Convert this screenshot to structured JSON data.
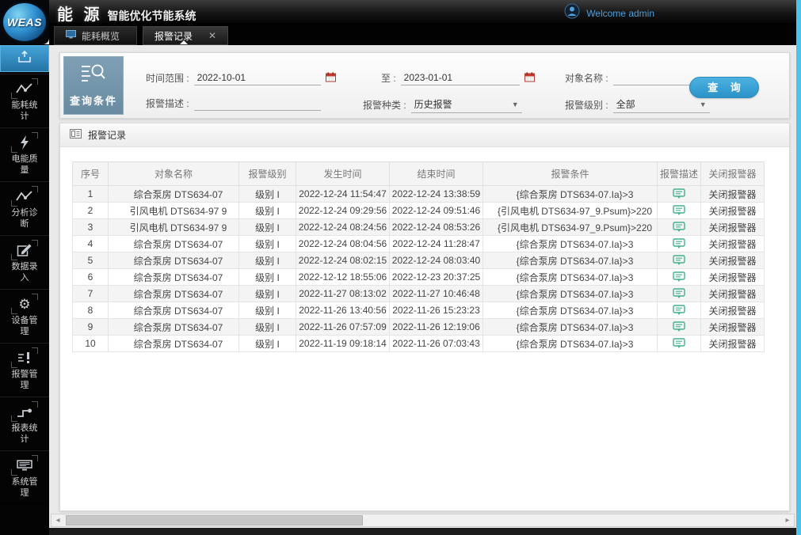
{
  "app": {
    "logo": "WEAS",
    "title_main": "能 源",
    "title_sub": "智能优化节能系统",
    "welcome": "Welcome admin"
  },
  "tabs": [
    {
      "label": "能耗概览",
      "active": false
    },
    {
      "label": "报警记录",
      "active": true,
      "close": "✕"
    }
  ],
  "sidebar": {
    "home": {
      "icon": "home-icon"
    },
    "items": [
      {
        "label": "能耗统计",
        "icon": "line-chart-icon"
      },
      {
        "label": "电能质量",
        "icon": "lightning-icon"
      },
      {
        "label": "分析诊断",
        "icon": "line-chart-icon"
      },
      {
        "label": "数据录入",
        "icon": "pencil-icon"
      },
      {
        "label": "设备管理",
        "icon": "gear-icon"
      },
      {
        "label": "报警管理",
        "icon": "alarm-icon"
      },
      {
        "label": "报表统计",
        "icon": "report-icon"
      },
      {
        "label": "系统管理",
        "icon": "monitor-icon"
      }
    ]
  },
  "query": {
    "panel_title": "查询条件",
    "time_range_label": "时间范围 :",
    "time_from": "2022-10-01",
    "to_label": "至 :",
    "time_to": "2023-01-01",
    "object_name_label": "对象名称 :",
    "object_name_value": "",
    "desc_label": "报警描述 :",
    "desc_value": "",
    "type_label": "报警种类 :",
    "type_value": "历史报警",
    "level_label": "报警级别 :",
    "level_value": "全部",
    "dropdown_arrow": "▼",
    "search_button": "查 询",
    "accent_color": "#2e9bd6"
  },
  "records": {
    "section_title": "报警记录",
    "columns": [
      "序号",
      "对象名称",
      "报警级别",
      "发生时间",
      "结束时间",
      "报警条件",
      "报警描述",
      "关闭报警器"
    ],
    "close_label": "关闭报警器",
    "rows": [
      {
        "no": "1",
        "name": "综合泵房 DTS634-07",
        "level": "级别 I",
        "start": "2022-12-24 11:54:47",
        "end": "2022-12-24 13:38:59",
        "condition": "{综合泵房 DTS634-07.Ia}>3"
      },
      {
        "no": "2",
        "name": "引风电机 DTS634-97 9",
        "level": "级别 I",
        "start": "2022-12-24 09:29:56",
        "end": "2022-12-24 09:51:46",
        "condition": "{引风电机 DTS634-97_9.Psum}>220"
      },
      {
        "no": "3",
        "name": "引风电机 DTS634-97 9",
        "level": "级别 I",
        "start": "2022-12-24 08:24:56",
        "end": "2022-12-24 08:53:26",
        "condition": "{引风电机 DTS634-97_9.Psum}>220"
      },
      {
        "no": "4",
        "name": "综合泵房 DTS634-07",
        "level": "级别 I",
        "start": "2022-12-24 08:04:56",
        "end": "2022-12-24 11:28:47",
        "condition": "{综合泵房 DTS634-07.Ia}>3"
      },
      {
        "no": "5",
        "name": "综合泵房 DTS634-07",
        "level": "级别 I",
        "start": "2022-12-24 08:02:15",
        "end": "2022-12-24 08:03:40",
        "condition": "{综合泵房 DTS634-07.Ia}>3"
      },
      {
        "no": "6",
        "name": "综合泵房 DTS634-07",
        "level": "级别 I",
        "start": "2022-12-12 18:55:06",
        "end": "2022-12-23 20:37:25",
        "condition": "{综合泵房 DTS634-07.Ia}>3"
      },
      {
        "no": "7",
        "name": "综合泵房 DTS634-07",
        "level": "级别 I",
        "start": "2022-11-27 08:13:02",
        "end": "2022-11-27 10:46:48",
        "condition": "{综合泵房 DTS634-07.Ia}>3"
      },
      {
        "no": "8",
        "name": "综合泵房 DTS634-07",
        "level": "级别 I",
        "start": "2022-11-26 13:40:56",
        "end": "2022-11-26 15:23:23",
        "condition": "{综合泵房 DTS634-07.Ia}>3"
      },
      {
        "no": "9",
        "name": "综合泵房 DTS634-07",
        "level": "级别 I",
        "start": "2022-11-26 07:57:09",
        "end": "2022-11-26 12:19:06",
        "condition": "{综合泵房 DTS634-07.Ia}>3"
      },
      {
        "no": "10",
        "name": "综合泵房 DTS634-07",
        "level": "级别 I",
        "start": "2022-11-19 09:18:14",
        "end": "2022-11-26 07:03:43",
        "condition": "{综合泵房 DTS634-07.Ia}>3"
      }
    ]
  },
  "colors": {
    "header_black": "#161616",
    "accent_blue": "#2e9bd6",
    "welcome_blue": "#4f9fdd",
    "query_box_blue": "#7295aa",
    "comment_green": "#44b08a",
    "edge_cyan": "#4cc3ea"
  }
}
